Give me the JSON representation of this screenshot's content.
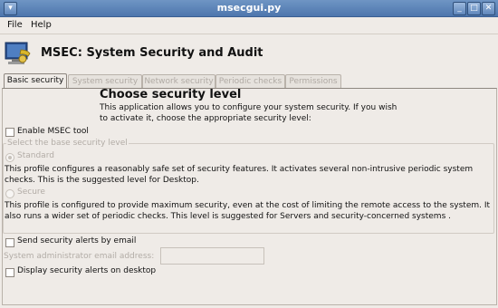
{
  "window": {
    "title": "msecgui.py"
  },
  "menu": {
    "file": "File",
    "help": "Help"
  },
  "header": {
    "title": "MSEC: System Security and Audit"
  },
  "tabs": [
    {
      "label": "Basic security"
    },
    {
      "label": "System security"
    },
    {
      "label": "Network security"
    },
    {
      "label": "Periodic checks"
    },
    {
      "label": "Permissions"
    }
  ],
  "basic": {
    "heading": "Choose security level",
    "description": "This application allows you to configure your system security. If you wish to activate it, choose the appropriate security level:",
    "enable_label": "Enable MSEC tool",
    "group_label": "Select the base security level",
    "standard_label": "Standard",
    "standard_desc": "This profile configures a reasonably safe set of security features. It activates several non-intrusive periodic system checks. This is the suggested level for Desktop.",
    "secure_label": "Secure",
    "secure_desc": "This profile is configured to provide maximum security, even at the cost of limiting the remote access to the system. It also runs a wider set of periodic checks. This level is suggested for Servers and security-concerned systems .",
    "alerts_email_label": "Send security alerts by email",
    "admin_email_label": "System administrator email address:",
    "admin_email_value": "",
    "alerts_desktop_label": "Display security alerts on desktop"
  },
  "colors": {
    "titlebar": "#5a82b8",
    "background": "#efebe7",
    "disabled_text": "#b2aca6"
  }
}
